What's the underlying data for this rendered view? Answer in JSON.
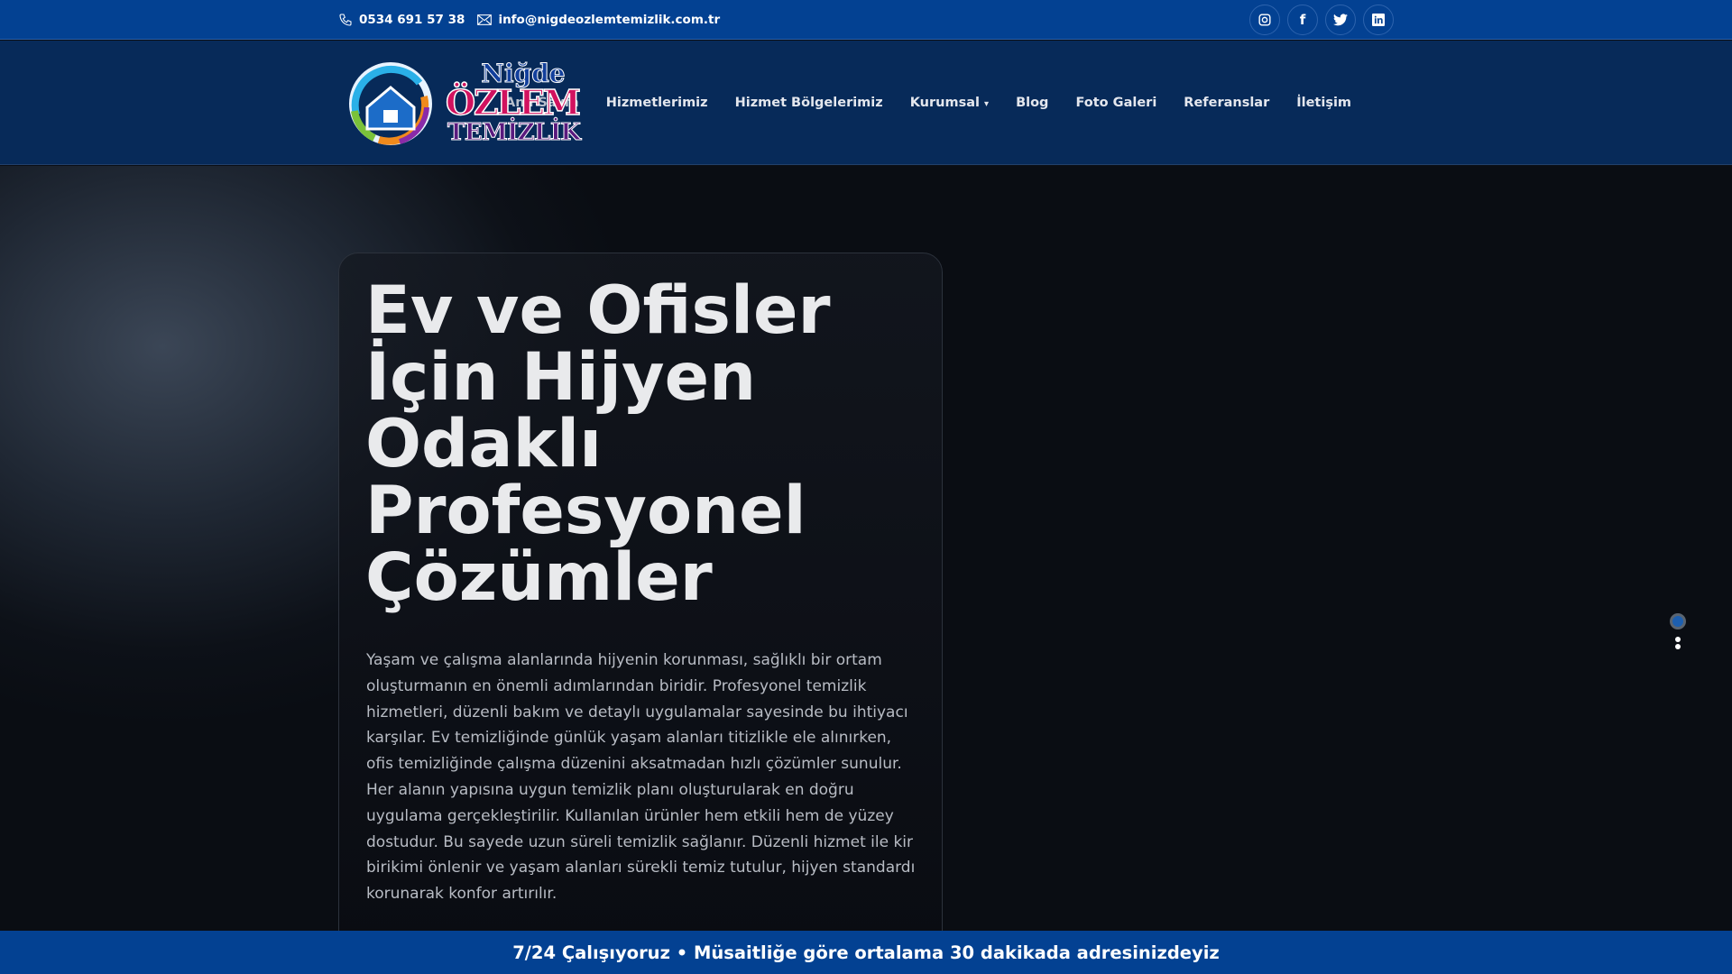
{
  "topbar": {
    "phone": "0534 691 57 38",
    "email": "info@nigdeozlemtemizlik.com.tr",
    "socials": [
      "instagram",
      "facebook",
      "twitter",
      "linkedin"
    ]
  },
  "logo": {
    "line1": "Niğde",
    "line2": "ÖZLEM",
    "line3": "TEMİZLİK"
  },
  "nav": {
    "items": [
      "Ana Sayfa",
      "Hizmetlerimiz",
      "Hizmet Bölgelerimiz",
      "Kurumsal",
      "Blog",
      "Foto Galeri",
      "Referanslar",
      "İletişim"
    ],
    "dropdown_arrow": "▾"
  },
  "hero": {
    "title": "Ev ve Ofisler İçin Hijyen Odaklı Profesyonel Çözümler",
    "description": "Yaşam ve çalışma alanlarında hijyenin korunması, sağlıklı bir ortam oluşturmanın en önemli adımlarından biridir. Profesyonel temizlik hizmetleri, düzenli bakım ve detaylı uygulamalar sayesinde bu ihtiyacı karşılar. Ev temizliğinde günlük yaşam alanları titizlikle ele alınırken, ofis temizliğinde çalışma düzenini aksatmadan hızlı çözümler sunulur. Her alanın yapısına uygun temizlik planı oluşturularak en doğru uygulama gerçekleştirilir. Kullanılan ürünler hem etkili hem de yüzey dostudur. Bu sayede uzun süreli temizlik sağlanır. Düzenli hizmet ile kir birikimi önlenir ve yaşam alanları sürekli temiz tutulur, hijyen standardı korunarak konfor artırılır."
  },
  "bottombar": {
    "text": "7/24 Çalışıyoruz • Müsaitliğe göre ortalama 30 dakikada adresinizdeyiz"
  }
}
